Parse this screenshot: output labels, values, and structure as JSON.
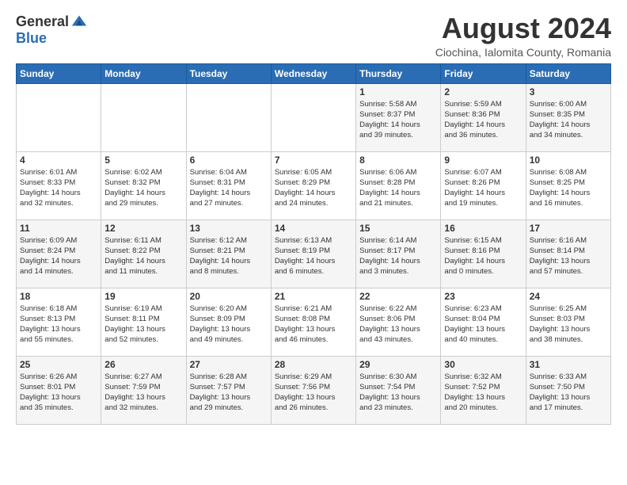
{
  "logo": {
    "general": "General",
    "blue": "Blue"
  },
  "header": {
    "month_year": "August 2024",
    "location": "Ciochina, Ialomita County, Romania"
  },
  "weekdays": [
    "Sunday",
    "Monday",
    "Tuesday",
    "Wednesday",
    "Thursday",
    "Friday",
    "Saturday"
  ],
  "weeks": [
    [
      {
        "day": "",
        "info": ""
      },
      {
        "day": "",
        "info": ""
      },
      {
        "day": "",
        "info": ""
      },
      {
        "day": "",
        "info": ""
      },
      {
        "day": "1",
        "info": "Sunrise: 5:58 AM\nSunset: 8:37 PM\nDaylight: 14 hours\nand 39 minutes."
      },
      {
        "day": "2",
        "info": "Sunrise: 5:59 AM\nSunset: 8:36 PM\nDaylight: 14 hours\nand 36 minutes."
      },
      {
        "day": "3",
        "info": "Sunrise: 6:00 AM\nSunset: 8:35 PM\nDaylight: 14 hours\nand 34 minutes."
      }
    ],
    [
      {
        "day": "4",
        "info": "Sunrise: 6:01 AM\nSunset: 8:33 PM\nDaylight: 14 hours\nand 32 minutes."
      },
      {
        "day": "5",
        "info": "Sunrise: 6:02 AM\nSunset: 8:32 PM\nDaylight: 14 hours\nand 29 minutes."
      },
      {
        "day": "6",
        "info": "Sunrise: 6:04 AM\nSunset: 8:31 PM\nDaylight: 14 hours\nand 27 minutes."
      },
      {
        "day": "7",
        "info": "Sunrise: 6:05 AM\nSunset: 8:29 PM\nDaylight: 14 hours\nand 24 minutes."
      },
      {
        "day": "8",
        "info": "Sunrise: 6:06 AM\nSunset: 8:28 PM\nDaylight: 14 hours\nand 21 minutes."
      },
      {
        "day": "9",
        "info": "Sunrise: 6:07 AM\nSunset: 8:26 PM\nDaylight: 14 hours\nand 19 minutes."
      },
      {
        "day": "10",
        "info": "Sunrise: 6:08 AM\nSunset: 8:25 PM\nDaylight: 14 hours\nand 16 minutes."
      }
    ],
    [
      {
        "day": "11",
        "info": "Sunrise: 6:09 AM\nSunset: 8:24 PM\nDaylight: 14 hours\nand 14 minutes."
      },
      {
        "day": "12",
        "info": "Sunrise: 6:11 AM\nSunset: 8:22 PM\nDaylight: 14 hours\nand 11 minutes."
      },
      {
        "day": "13",
        "info": "Sunrise: 6:12 AM\nSunset: 8:21 PM\nDaylight: 14 hours\nand 8 minutes."
      },
      {
        "day": "14",
        "info": "Sunrise: 6:13 AM\nSunset: 8:19 PM\nDaylight: 14 hours\nand 6 minutes."
      },
      {
        "day": "15",
        "info": "Sunrise: 6:14 AM\nSunset: 8:17 PM\nDaylight: 14 hours\nand 3 minutes."
      },
      {
        "day": "16",
        "info": "Sunrise: 6:15 AM\nSunset: 8:16 PM\nDaylight: 14 hours\nand 0 minutes."
      },
      {
        "day": "17",
        "info": "Sunrise: 6:16 AM\nSunset: 8:14 PM\nDaylight: 13 hours\nand 57 minutes."
      }
    ],
    [
      {
        "day": "18",
        "info": "Sunrise: 6:18 AM\nSunset: 8:13 PM\nDaylight: 13 hours\nand 55 minutes."
      },
      {
        "day": "19",
        "info": "Sunrise: 6:19 AM\nSunset: 8:11 PM\nDaylight: 13 hours\nand 52 minutes."
      },
      {
        "day": "20",
        "info": "Sunrise: 6:20 AM\nSunset: 8:09 PM\nDaylight: 13 hours\nand 49 minutes."
      },
      {
        "day": "21",
        "info": "Sunrise: 6:21 AM\nSunset: 8:08 PM\nDaylight: 13 hours\nand 46 minutes."
      },
      {
        "day": "22",
        "info": "Sunrise: 6:22 AM\nSunset: 8:06 PM\nDaylight: 13 hours\nand 43 minutes."
      },
      {
        "day": "23",
        "info": "Sunrise: 6:23 AM\nSunset: 8:04 PM\nDaylight: 13 hours\nand 40 minutes."
      },
      {
        "day": "24",
        "info": "Sunrise: 6:25 AM\nSunset: 8:03 PM\nDaylight: 13 hours\nand 38 minutes."
      }
    ],
    [
      {
        "day": "25",
        "info": "Sunrise: 6:26 AM\nSunset: 8:01 PM\nDaylight: 13 hours\nand 35 minutes."
      },
      {
        "day": "26",
        "info": "Sunrise: 6:27 AM\nSunset: 7:59 PM\nDaylight: 13 hours\nand 32 minutes."
      },
      {
        "day": "27",
        "info": "Sunrise: 6:28 AM\nSunset: 7:57 PM\nDaylight: 13 hours\nand 29 minutes."
      },
      {
        "day": "28",
        "info": "Sunrise: 6:29 AM\nSunset: 7:56 PM\nDaylight: 13 hours\nand 26 minutes."
      },
      {
        "day": "29",
        "info": "Sunrise: 6:30 AM\nSunset: 7:54 PM\nDaylight: 13 hours\nand 23 minutes."
      },
      {
        "day": "30",
        "info": "Sunrise: 6:32 AM\nSunset: 7:52 PM\nDaylight: 13 hours\nand 20 minutes."
      },
      {
        "day": "31",
        "info": "Sunrise: 6:33 AM\nSunset: 7:50 PM\nDaylight: 13 hours\nand 17 minutes."
      }
    ]
  ]
}
